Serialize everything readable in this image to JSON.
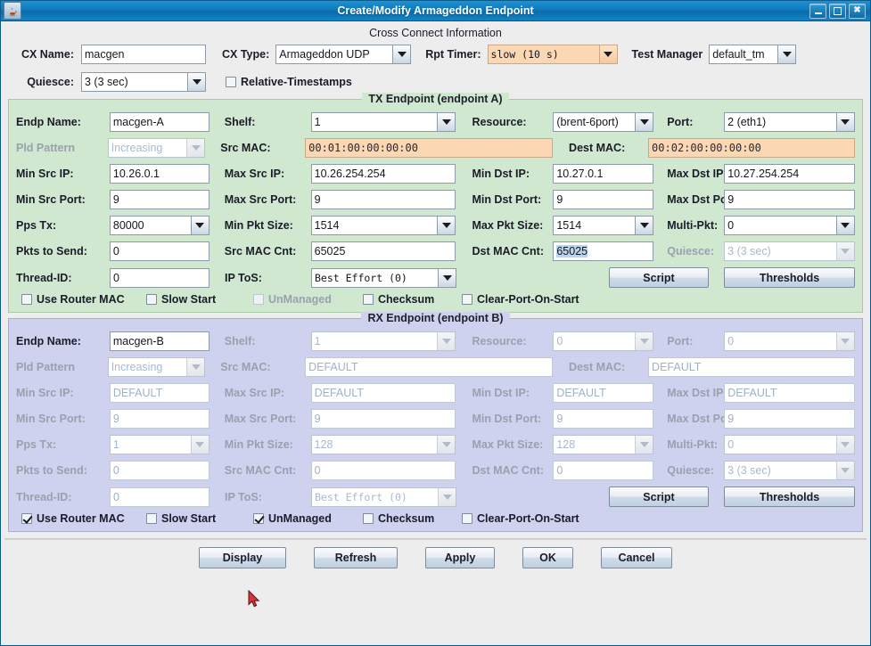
{
  "window": {
    "title": "Create/Modify Armageddon Endpoint",
    "app_icon": "java-coffee-cup-icon",
    "buttons": {
      "minimize": "minimize-icon",
      "maximize": "maximize-icon",
      "close": "✖"
    }
  },
  "cross_connect": {
    "title": "Cross Connect Information",
    "cx_name_label": "CX Name:",
    "cx_name_value": "macgen",
    "cx_type_label": "CX Type:",
    "cx_type_value": "Armageddon UDP",
    "rpt_timer_label": "Rpt Timer:",
    "rpt_timer_value": "slow     (10 s)",
    "test_manager_label": "Test Manager",
    "test_manager_value": "default_tm",
    "quiesce_label": "Quiesce:",
    "quiesce_value": "3 (3 sec)",
    "relative_timestamps_label": "Relative-Timestamps",
    "relative_timestamps_checked": false
  },
  "tx": {
    "title": "TX Endpoint (endpoint A)",
    "endp_name_label": "Endp Name:",
    "endp_name_value": "macgen-A",
    "shelf_label": "Shelf:",
    "shelf_value": "1",
    "resource_label": "Resource:",
    "resource_value": "(brent-6port)",
    "port_label": "Port:",
    "port_value": "2 (eth1)",
    "pld_pattern_label": "Pld Pattern",
    "pld_pattern_value": "Increasing",
    "src_mac_label": "Src MAC:",
    "src_mac_value": "00:01:00:00:00:00",
    "dest_mac_label": "Dest MAC:",
    "dest_mac_value": "00:02:00:00:00:00",
    "min_src_ip_label": "Min Src IP:",
    "min_src_ip_value": "10.26.0.1",
    "max_src_ip_label": "Max Src IP:",
    "max_src_ip_value": "10.26.254.254",
    "min_dst_ip_label": "Min Dst IP:",
    "min_dst_ip_value": "10.27.0.1",
    "max_dst_ip_label": "Max Dst IP:",
    "max_dst_ip_value": "10.27.254.254",
    "min_src_port_label": "Min Src Port:",
    "min_src_port_value": "9",
    "max_src_port_label": "Max Src Port:",
    "max_src_port_value": "9",
    "min_dst_port_label": "Min Dst Port:",
    "min_dst_port_value": "9",
    "max_dst_port_label": "Max Dst Port:",
    "max_dst_port_value": "9",
    "pps_tx_label": "Pps Tx:",
    "pps_tx_value": "80000",
    "min_pkt_size_label": "Min Pkt Size:",
    "min_pkt_size_value": "1514",
    "max_pkt_size_label": "Max Pkt Size:",
    "max_pkt_size_value": "1514",
    "multi_pkt_label": "Multi-Pkt:",
    "multi_pkt_value": "0",
    "pkts_to_send_label": "Pkts to Send:",
    "pkts_to_send_value": "0",
    "src_mac_cnt_label": "Src MAC Cnt:",
    "src_mac_cnt_value": "65025",
    "dst_mac_cnt_label": "Dst MAC Cnt:",
    "dst_mac_cnt_value": "65025",
    "quiesce_label": "Quiesce:",
    "quiesce_value": "3 (3 sec)",
    "thread_id_label": "Thread-ID:",
    "thread_id_value": "0",
    "ip_tos_label": "IP ToS:",
    "ip_tos_value": "Best Effort    (0)",
    "script_label": "Script",
    "thresholds_label": "Thresholds",
    "checkboxes": [
      {
        "label": "Use Router MAC",
        "checked": false,
        "disabled": false,
        "name": "use-router-mac"
      },
      {
        "label": "Slow Start",
        "checked": false,
        "disabled": false,
        "name": "slow-start"
      },
      {
        "label": "UnManaged",
        "checked": false,
        "disabled": true,
        "name": "unmanaged"
      },
      {
        "label": "Checksum",
        "checked": false,
        "disabled": false,
        "name": "checksum"
      },
      {
        "label": "Clear-Port-On-Start",
        "checked": false,
        "disabled": false,
        "name": "clear-port-on-start"
      }
    ]
  },
  "rx": {
    "title": "RX Endpoint (endpoint B)",
    "endp_name_label": "Endp Name:",
    "endp_name_value": "macgen-B",
    "shelf_label": "Shelf:",
    "shelf_value": "1",
    "resource_label": "Resource:",
    "resource_value": "0",
    "port_label": "Port:",
    "port_value": "0",
    "pld_pattern_label": "Pld Pattern",
    "pld_pattern_value": "Increasing",
    "src_mac_label": "Src MAC:",
    "src_mac_value": "DEFAULT",
    "dest_mac_label": "Dest MAC:",
    "dest_mac_value": "DEFAULT",
    "min_src_ip_label": "Min Src IP:",
    "min_src_ip_value": "DEFAULT",
    "max_src_ip_label": "Max Src IP:",
    "max_src_ip_value": "DEFAULT",
    "min_dst_ip_label": "Min Dst IP:",
    "min_dst_ip_value": "DEFAULT",
    "max_dst_ip_label": "Max Dst IP:",
    "max_dst_ip_value": "DEFAULT",
    "min_src_port_label": "Min Src Port:",
    "min_src_port_value": "9",
    "max_src_port_label": "Max Src Port:",
    "max_src_port_value": "9",
    "min_dst_port_label": "Min Dst Port:",
    "min_dst_port_value": "9",
    "max_dst_port_label": "Max Dst Port:",
    "max_dst_port_value": "9",
    "pps_tx_label": "Pps Tx:",
    "pps_tx_value": "1",
    "min_pkt_size_label": "Min Pkt Size:",
    "min_pkt_size_value": "128",
    "max_pkt_size_label": "Max Pkt Size:",
    "max_pkt_size_value": "128",
    "multi_pkt_label": "Multi-Pkt:",
    "multi_pkt_value": "0",
    "pkts_to_send_label": "Pkts to Send:",
    "pkts_to_send_value": "0",
    "src_mac_cnt_label": "Src MAC Cnt:",
    "src_mac_cnt_value": "0",
    "dst_mac_cnt_label": "Dst MAC Cnt:",
    "dst_mac_cnt_value": "0",
    "quiesce_label": "Quiesce:",
    "quiesce_value": "3 (3 sec)",
    "thread_id_label": "Thread-ID:",
    "thread_id_value": "0",
    "ip_tos_label": "IP ToS:",
    "ip_tos_value": "Best Effort    (0)",
    "script_label": "Script",
    "thresholds_label": "Thresholds",
    "checkboxes": [
      {
        "label": "Use Router MAC",
        "checked": true,
        "disabled": false,
        "name": "use-router-mac"
      },
      {
        "label": "Slow Start",
        "checked": false,
        "disabled": false,
        "name": "slow-start"
      },
      {
        "label": "UnManaged",
        "checked": true,
        "disabled": false,
        "name": "unmanaged"
      },
      {
        "label": "Checksum",
        "checked": false,
        "disabled": false,
        "name": "checksum"
      },
      {
        "label": "Clear-Port-On-Start",
        "checked": false,
        "disabled": false,
        "name": "clear-port-on-start"
      }
    ]
  },
  "footer": {
    "display": "Display",
    "refresh": "Refresh",
    "apply": "Apply",
    "ok": "OK",
    "cancel": "Cancel"
  },
  "colors": {
    "titlebar": "#0e79bb",
    "tx_panel": "#cfe8cf",
    "rx_panel": "#ced2ef",
    "highlight_field": "#fbd7b4",
    "selection": "#bcd5ef"
  }
}
